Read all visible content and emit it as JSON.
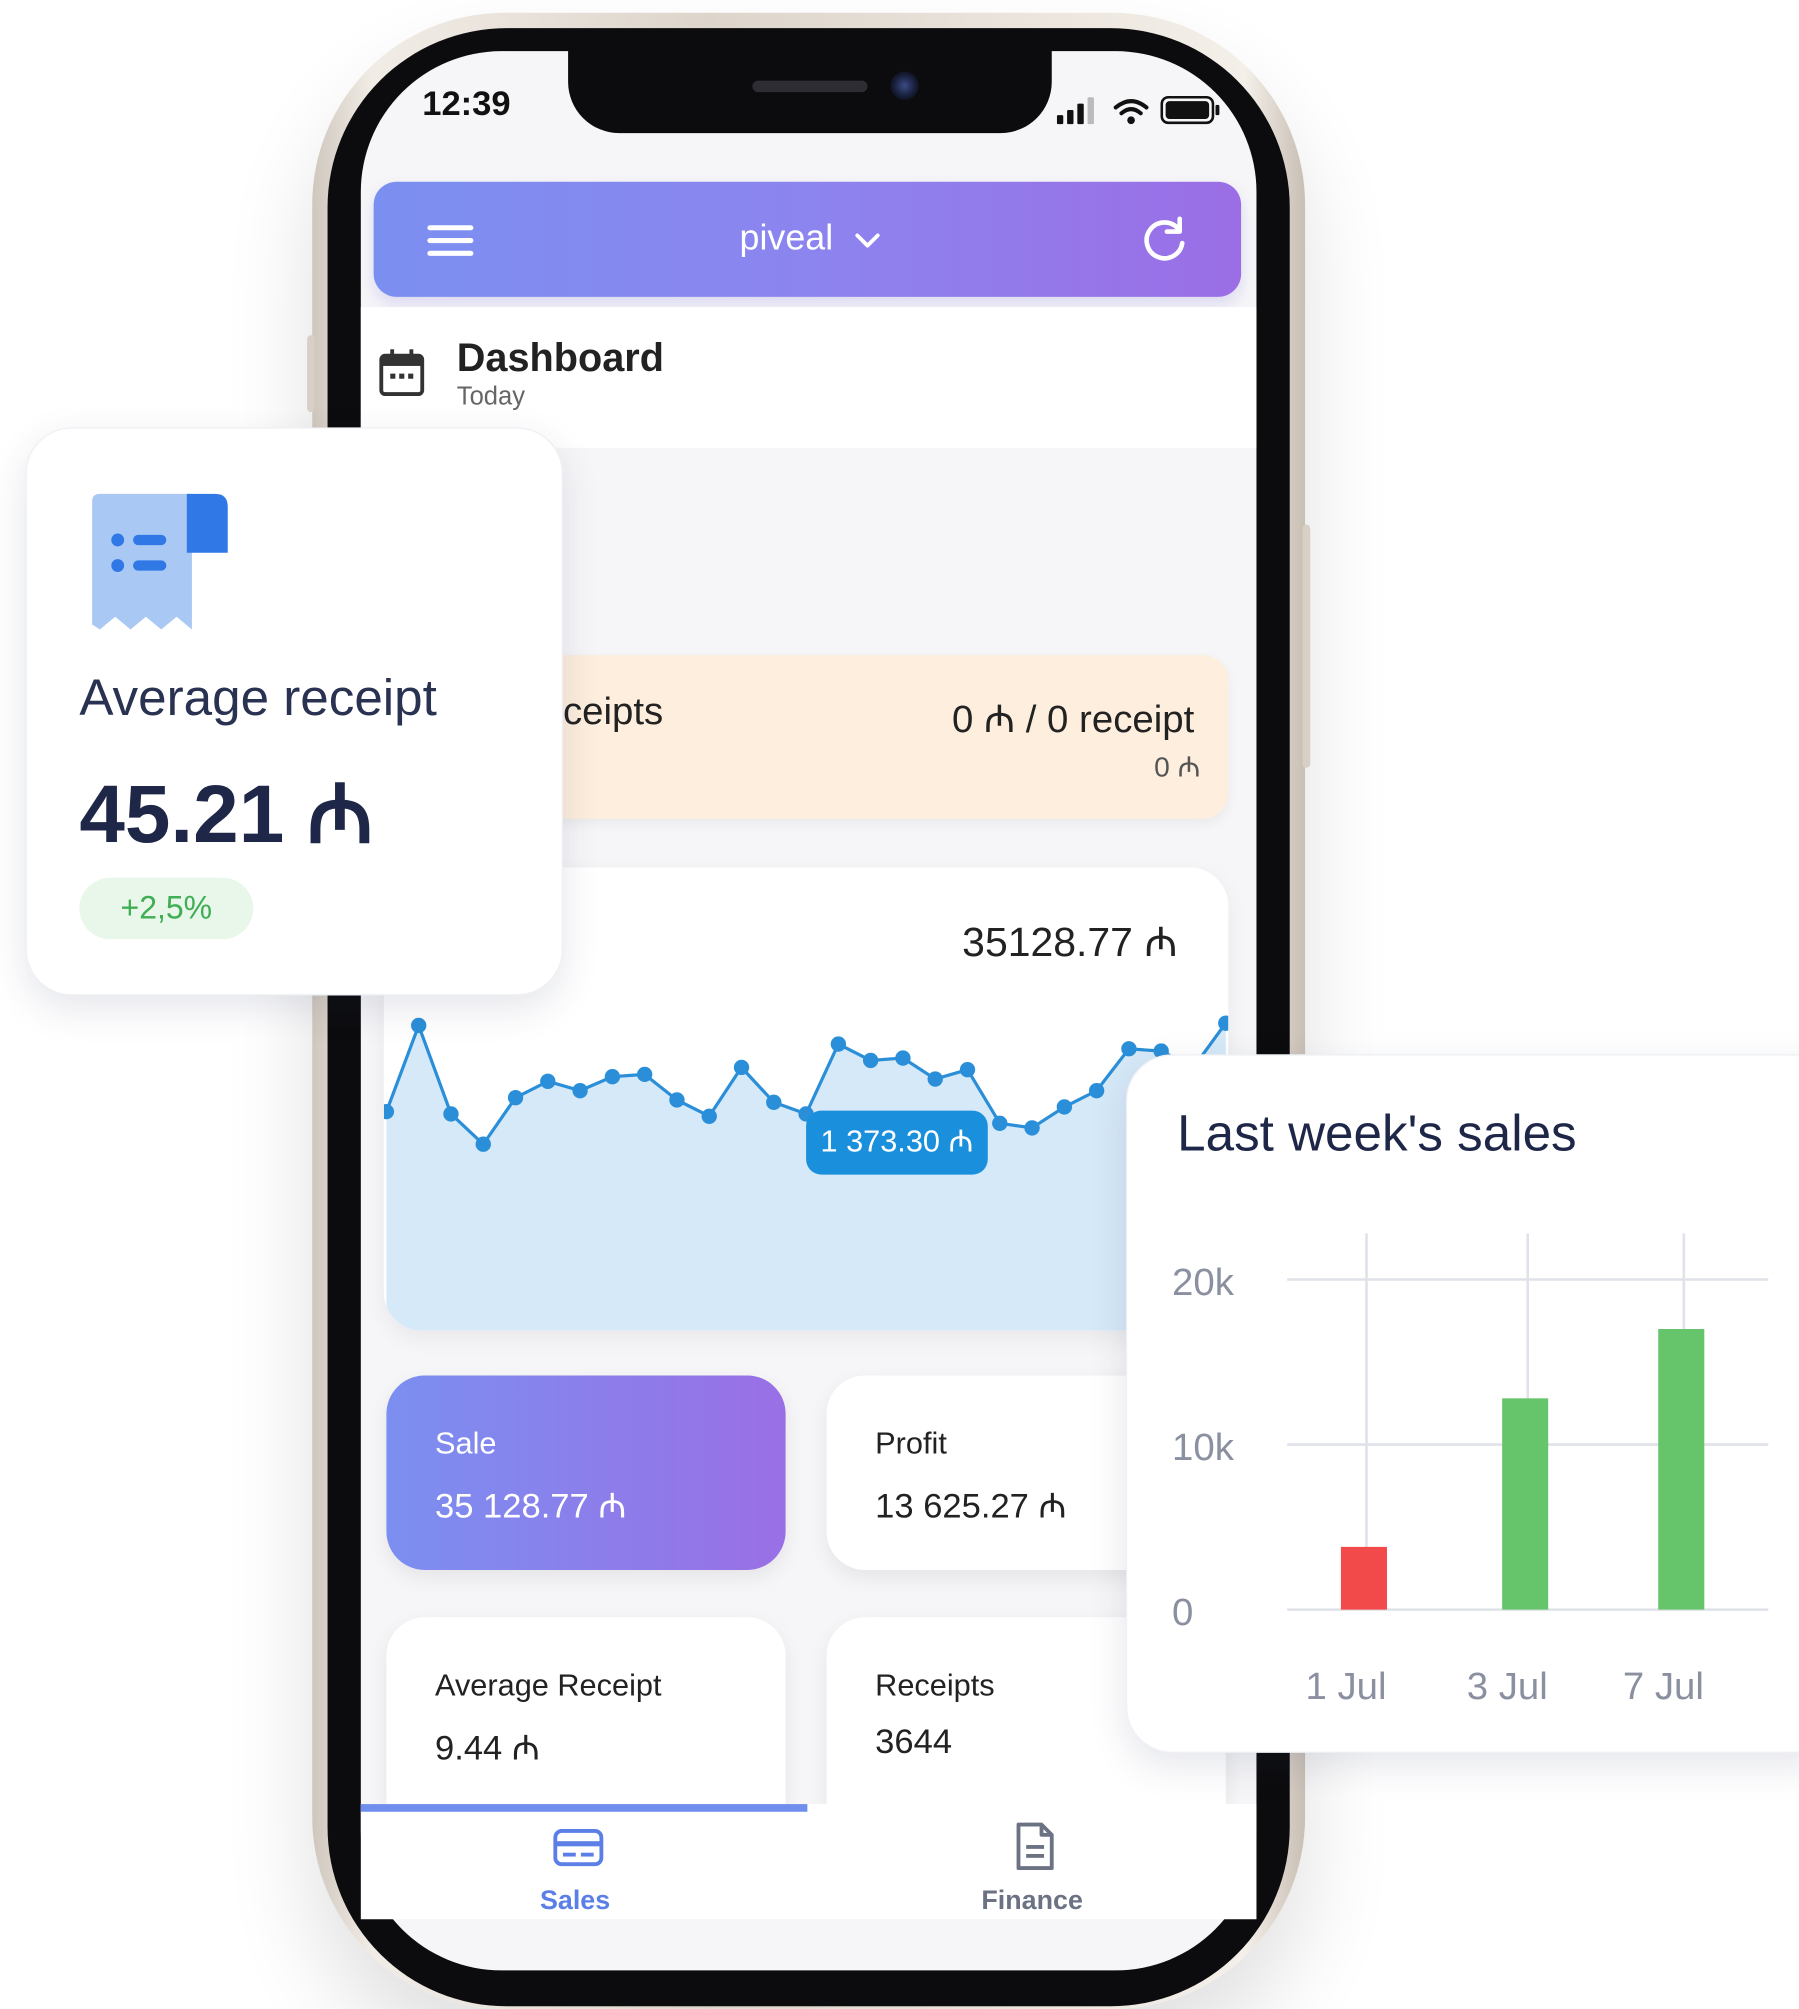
{
  "status_bar": {
    "time": "12:39"
  },
  "header": {
    "store_name": "piveal"
  },
  "dashboard": {
    "title": "Dashboard",
    "period": "Today"
  },
  "receipts_card": {
    "label": "ceipts",
    "value": "0 ₼ / 0 receipt",
    "sub_value": "0 ₼"
  },
  "sales_chart": {
    "total": "35128.77 ₼",
    "tooltip": "1 373.30 ₼"
  },
  "metrics": [
    {
      "label": "Sale",
      "value": "35 128.77 ₼",
      "active": true
    },
    {
      "label": "Profit",
      "value": "13 625.27 ₼",
      "active": false
    },
    {
      "label": "Average Receipt",
      "value": "9.44 ₼",
      "active": false
    },
    {
      "label": "Receipts",
      "value": "3644",
      "active": false
    }
  ],
  "tabs": [
    {
      "label": "Sales",
      "icon": "card-icon",
      "active": true,
      "color": "#5b7fe6"
    },
    {
      "label": "Finance",
      "icon": "document-icon",
      "active": false,
      "color": "#6b7284"
    }
  ],
  "average_receipt_card": {
    "title": "Average receipt",
    "value": "45.21 ₼",
    "change": "+2,5%"
  },
  "colors": {
    "header_gradient": [
      "#7b8ff0",
      "#9b6ee6"
    ],
    "line": "#2a8fd8",
    "area": "#d6e9f8",
    "bar_negative": "#f24a4a",
    "bar_positive": "#66c46a",
    "badge_text": "#3fae54"
  },
  "line_chart_data": {
    "type": "line",
    "values": [
      0.6,
      0.97,
      0.59,
      0.46,
      0.66,
      0.73,
      0.69,
      0.75,
      0.76,
      0.65,
      0.58,
      0.79,
      0.64,
      0.59,
      0.89,
      0.82,
      0.83,
      0.74,
      0.78,
      0.55,
      0.53,
      0.62,
      0.69,
      0.87,
      0.86,
      0.79,
      0.98
    ]
  },
  "chart_data": {
    "type": "bar",
    "title": "Last week's sales",
    "categories": [
      "1 Jul",
      "3 Jul",
      "7 Jul"
    ],
    "values": [
      3800,
      12800,
      17000
    ],
    "colors": [
      "#f24a4a",
      "#66c46a",
      "#66c46a"
    ],
    "yticks": [
      "0",
      "10k",
      "20k"
    ],
    "ylim": [
      0,
      20000
    ],
    "grid": true
  }
}
